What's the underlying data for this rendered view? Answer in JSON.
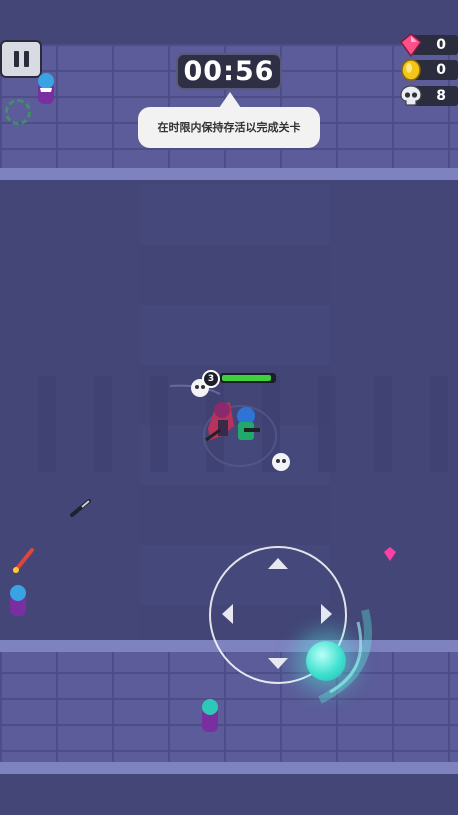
{
  "hud": {
    "timer": "00:56",
    "objective": "在时限内保持存活以完成关卡",
    "gems": "0",
    "coins": "0",
    "kills": "8"
  },
  "player": {
    "level": "3",
    "health_fraction": 0.95
  },
  "icons": {
    "pause": "pause-icon",
    "gem": "pink-gem-icon",
    "coin": "gold-coin-icon",
    "skull": "skull-icon",
    "joystick": "virtual-joystick"
  },
  "colors": {
    "floor": "#434677",
    "wall": "#5b5c99",
    "health": "#3cd23c",
    "joystick_knob": "#3fe0cf",
    "gem": "#ff4f8b",
    "coin": "#f5c518"
  }
}
